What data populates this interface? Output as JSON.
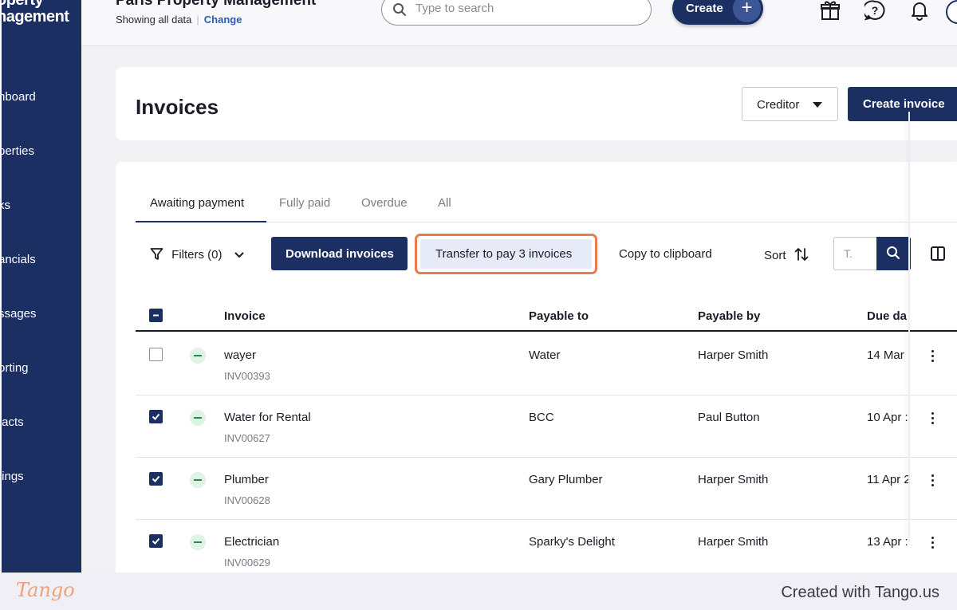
{
  "sidebar": {
    "brand_line1": "operty",
    "brand_line2": "nagement",
    "items": [
      {
        "label": "hboard"
      },
      {
        "label": "perties"
      },
      {
        "label": "ks"
      },
      {
        "label": "ancials"
      },
      {
        "label": "ssages"
      },
      {
        "label": "orting"
      },
      {
        "label": "tacts"
      },
      {
        "label": "tings"
      }
    ]
  },
  "topbar": {
    "org_name": "Paris Property Management",
    "showing_text": "Showing all data",
    "change_label": "Change",
    "search_placeholder": "Type to search",
    "create_label": "Create",
    "create_plus": "+",
    "icons": [
      "gift-icon",
      "help-icon",
      "bell-icon"
    ]
  },
  "header": {
    "title": "Invoices",
    "creditor_label": "Creditor",
    "create_invoice_label": "Create invoice"
  },
  "tabs": [
    {
      "label": "Awaiting payment",
      "active": true
    },
    {
      "label": "Fully paid",
      "active": false
    },
    {
      "label": "Overdue",
      "active": false
    },
    {
      "label": "All",
      "active": false
    }
  ],
  "toolbar": {
    "filters_label": "Filters (0)",
    "download_label": "Download invoices",
    "transfer_label": "Transfer to pay 3 invoices",
    "copy_label": "Copy to clipboard",
    "sort_label": "Sort",
    "mini_search_placeholder": "T."
  },
  "table": {
    "columns": [
      "Invoice",
      "Payable to",
      "Payable by",
      "Due da"
    ],
    "rows": [
      {
        "checked": false,
        "name": "wayer",
        "id": "INV00393",
        "payable_to": "Water",
        "payable_by": "Harper Smith",
        "due": "14 Mar"
      },
      {
        "checked": true,
        "name": "Water for Rental",
        "id": "INV00627",
        "payable_to": "BCC",
        "payable_by": "Paul Button",
        "due": "10 Apr :"
      },
      {
        "checked": true,
        "name": "Plumber",
        "id": "INV00628",
        "payable_to": "Gary Plumber",
        "payable_by": "Harper Smith",
        "due": "11 Apr 2"
      },
      {
        "checked": true,
        "name": "Electrician",
        "id": "INV00629",
        "payable_to": "Sparky's Delight",
        "payable_by": "Harper Smith",
        "due": "13 Apr :"
      }
    ]
  },
  "footer": {
    "logo_text": "Tango",
    "created_text": "Created with Tango.us"
  },
  "colors": {
    "navy": "#1b2f63",
    "highlight": "#ec7a4f",
    "status_green": "#2e8a4f"
  }
}
